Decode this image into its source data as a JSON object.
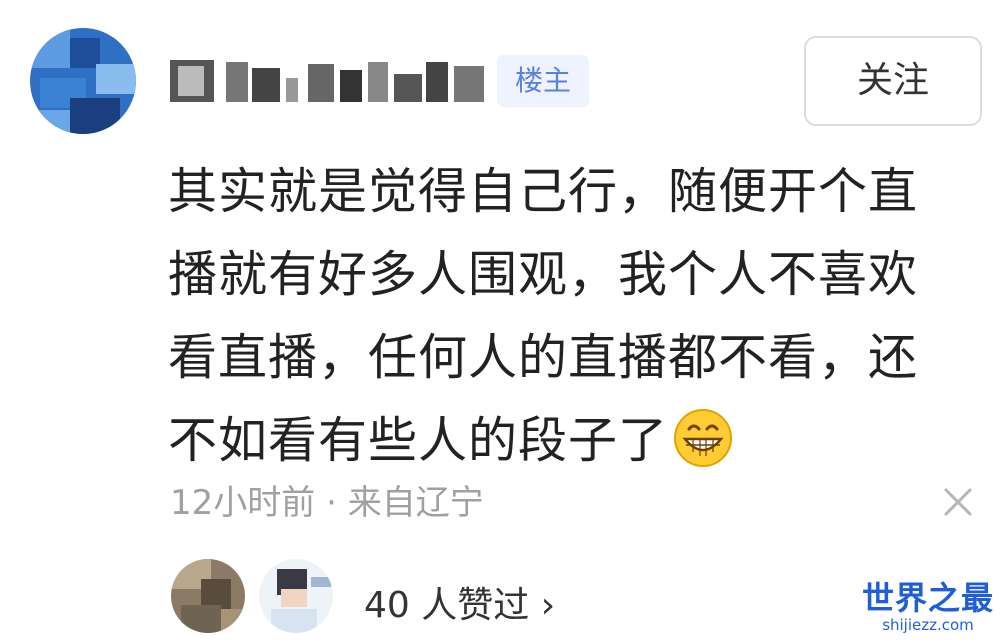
{
  "post": {
    "badge": "楼主",
    "follow_label": "关注",
    "content_lines": [
      "其实就是觉得自己行，随便开个直",
      "播就有好多人围观，我个人不喜欢",
      "看直播，任何人的直播都不看，还",
      "不如看有些人的段子了"
    ],
    "emoji_icon": "grinning-emoji",
    "time": "12小时前",
    "separator": "·",
    "location": "来自辽宁",
    "likes_label": "40 人赞过",
    "likes_chevron": "›"
  },
  "watermark": {
    "title": "世界之最",
    "url": "shijiezz.com"
  }
}
